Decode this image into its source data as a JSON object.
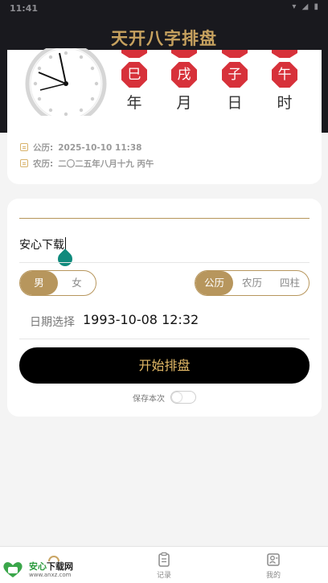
{
  "status_bar": {
    "time": "11:41",
    "icons": "▾ ◢ ▮"
  },
  "app": {
    "title": "天开八字排盘"
  },
  "pillars": [
    {
      "top_char": "",
      "char": "巳",
      "label": "年"
    },
    {
      "top_char": "",
      "char": "戌",
      "label": "月"
    },
    {
      "top_char": "",
      "char": "子",
      "label": "日"
    },
    {
      "top_char": "",
      "char": "午",
      "label": "时"
    }
  ],
  "dates": {
    "gregorian_label": "公历:",
    "gregorian_value": "2025-10-10 11:38",
    "lunar_label": "农历:",
    "lunar_value": "二〇二五年八月十九 丙午"
  },
  "form": {
    "name_value": "安心下载",
    "gender_options": [
      "男",
      "女"
    ],
    "gender_selected": "男",
    "calendar_options": [
      "公历",
      "农历",
      "四柱"
    ],
    "calendar_selected": "公历",
    "date_label": "日期选择",
    "date_value": "1993-10-08 12:32",
    "start_button": "开始排盘",
    "save_label": "保存本次",
    "save_toggle": false
  },
  "nav": {
    "items": [
      {
        "label": "",
        "icon": "home-icon"
      },
      {
        "label": "记录",
        "icon": "record-icon"
      },
      {
        "label": "我的",
        "icon": "profile-icon"
      }
    ]
  },
  "watermark": {
    "main_green": "安心",
    "main_dark": "下载网",
    "sub": "www.anxz.com"
  },
  "colors": {
    "header": "#19191e",
    "gold": "#b7965d",
    "red": "#d7313a",
    "title_gold": "#c7a25f",
    "teal": "#0f8a7c"
  }
}
